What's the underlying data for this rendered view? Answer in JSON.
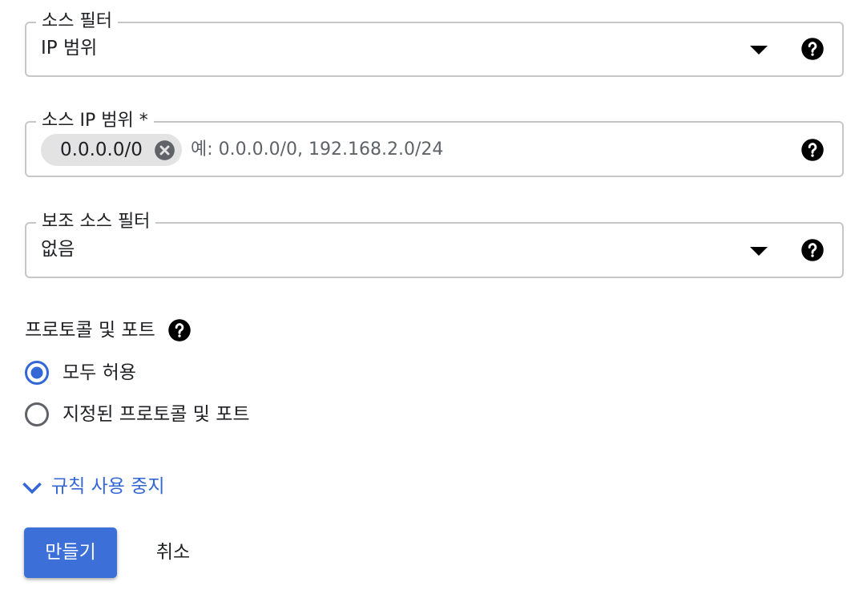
{
  "source_filter": {
    "label": "소스 필터",
    "value": "IP 범위",
    "dropdown_icon": "arrow-drop-down-icon",
    "help_icon": "help-icon"
  },
  "source_ip_ranges": {
    "label": "소스 IP 범위 *",
    "chips": [
      {
        "text": "0.0.0.0/0",
        "remove_icon": "cancel-icon"
      }
    ],
    "placeholder": "예: 0.0.0.0/0, 192.168.2.0/24",
    "help_icon": "help-icon"
  },
  "secondary_source_filter": {
    "label": "보조 소스 필터",
    "value": "없음",
    "dropdown_icon": "arrow-drop-down-icon",
    "help_icon": "help-icon"
  },
  "protocols_ports": {
    "title": "프로토콜 및 포트",
    "help_icon": "help-icon",
    "options": [
      {
        "label": "모두 허용",
        "selected": true
      },
      {
        "label": "지정된 프로토콜 및 포트",
        "selected": false
      }
    ]
  },
  "expander": {
    "label": "규칙 사용 중지",
    "icon": "chevron-down-icon"
  },
  "actions": {
    "create_label": "만들기",
    "cancel_label": "취소"
  },
  "colors": {
    "primary": "#3c6fd8",
    "link": "#3367d6",
    "radio_selected": "#3367d6",
    "radio_unselected": "#5f6368",
    "field_border": "#c7c7c7",
    "chip_background": "#e3e3e3"
  }
}
